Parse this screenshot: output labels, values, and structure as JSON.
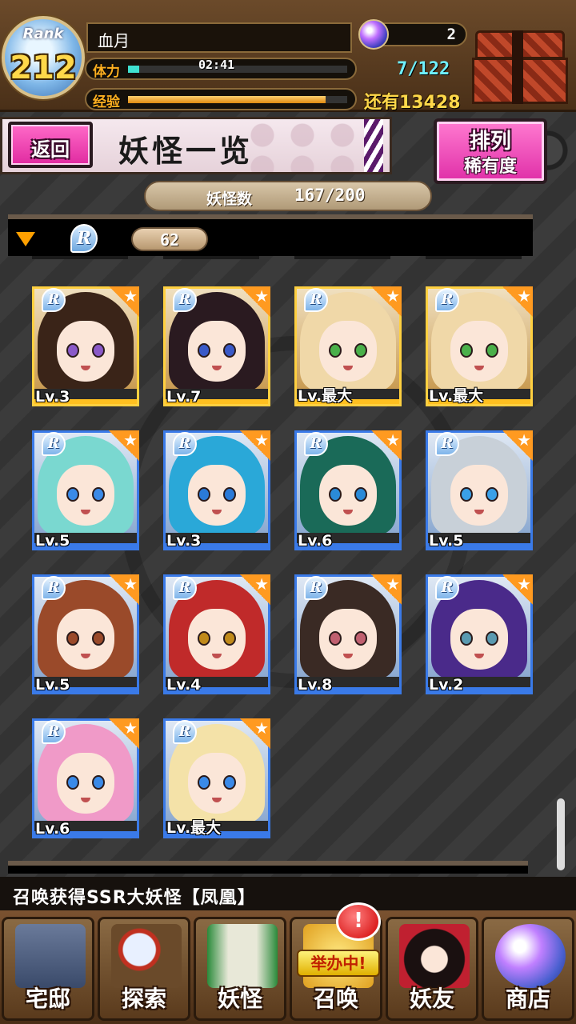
{
  "player": {
    "rank_label": "Rank",
    "rank": "212",
    "name": "血月",
    "stamina_label": "体力",
    "stamina_timer": "02:41",
    "stamina_fraction": 0.05,
    "stamina_display": "7/122",
    "exp_label": "经验",
    "exp_fraction": 0.9,
    "exp_remaining": "还有13428",
    "gems": "2"
  },
  "header": {
    "back_label": "返回",
    "title": "妖怪一览",
    "sort_title": "排列",
    "sort_value": "稀有度"
  },
  "monster_count": {
    "label": "妖怪数",
    "value": "167/200"
  },
  "group": {
    "rarity": "R",
    "count": "62"
  },
  "cards": [
    {
      "rarity": "R",
      "level": "Lv.3",
      "frame": "gold",
      "hair": "#3a2418",
      "eye": "#8a5ac8"
    },
    {
      "rarity": "R",
      "level": "Lv.7",
      "frame": "gold",
      "hair": "#2a1a20",
      "eye": "#3a5ac8"
    },
    {
      "rarity": "R",
      "level": "Lv.最大",
      "frame": "gold",
      "hair": "#f0d8a8",
      "eye": "#4ab04a"
    },
    {
      "rarity": "R",
      "level": "Lv.最大",
      "frame": "gold",
      "hair": "#f0d8a8",
      "eye": "#4ab04a"
    },
    {
      "rarity": "R",
      "level": "Lv.5",
      "frame": "blue",
      "hair": "#7ad8d0",
      "eye": "#3a8ae8"
    },
    {
      "rarity": "R",
      "level": "Lv.3",
      "frame": "blue",
      "hair": "#2aa8d8",
      "eye": "#2a7ad8"
    },
    {
      "rarity": "R",
      "level": "Lv.6",
      "frame": "blue",
      "hair": "#1a6a58",
      "eye": "#2a8ad8"
    },
    {
      "rarity": "R",
      "level": "Lv.5",
      "frame": "blue",
      "hair": "#c8d0d8",
      "eye": "#3aa0e8"
    },
    {
      "rarity": "R",
      "level": "Lv.5",
      "frame": "blue",
      "hair": "#9a4a2a",
      "eye": "#9a4a2a"
    },
    {
      "rarity": "R",
      "level": "Lv.4",
      "frame": "blue",
      "hair": "#c02a2a",
      "eye": "#c08a1a"
    },
    {
      "rarity": "R",
      "level": "Lv.8",
      "frame": "blue",
      "hair": "#3a2a24",
      "eye": "#c06070"
    },
    {
      "rarity": "R",
      "level": "Lv.2",
      "frame": "blue",
      "hair": "#4a2a8a",
      "eye": "#5a9ab0"
    },
    {
      "rarity": "R",
      "level": "Lv.6",
      "frame": "blue",
      "hair": "#f09ac8",
      "eye": "#3a8ae8"
    },
    {
      "rarity": "R",
      "level": "Lv.最大",
      "frame": "blue",
      "hair": "#f4e2a8",
      "eye": "#3a8ae8"
    }
  ],
  "ticker": "召唤获得SSR大妖怪【凤凰】",
  "nav": {
    "home": "宅邸",
    "explore": "探索",
    "monsters": "妖怪",
    "summon": "召唤",
    "summon_badge": "举办中!",
    "friends": "妖友",
    "shop": "商店",
    "alert": "!"
  },
  "colors": {
    "gold_frame": "#ffd040",
    "blue_frame": "#3a7ae8",
    "accent_pink": "#e030a8"
  }
}
